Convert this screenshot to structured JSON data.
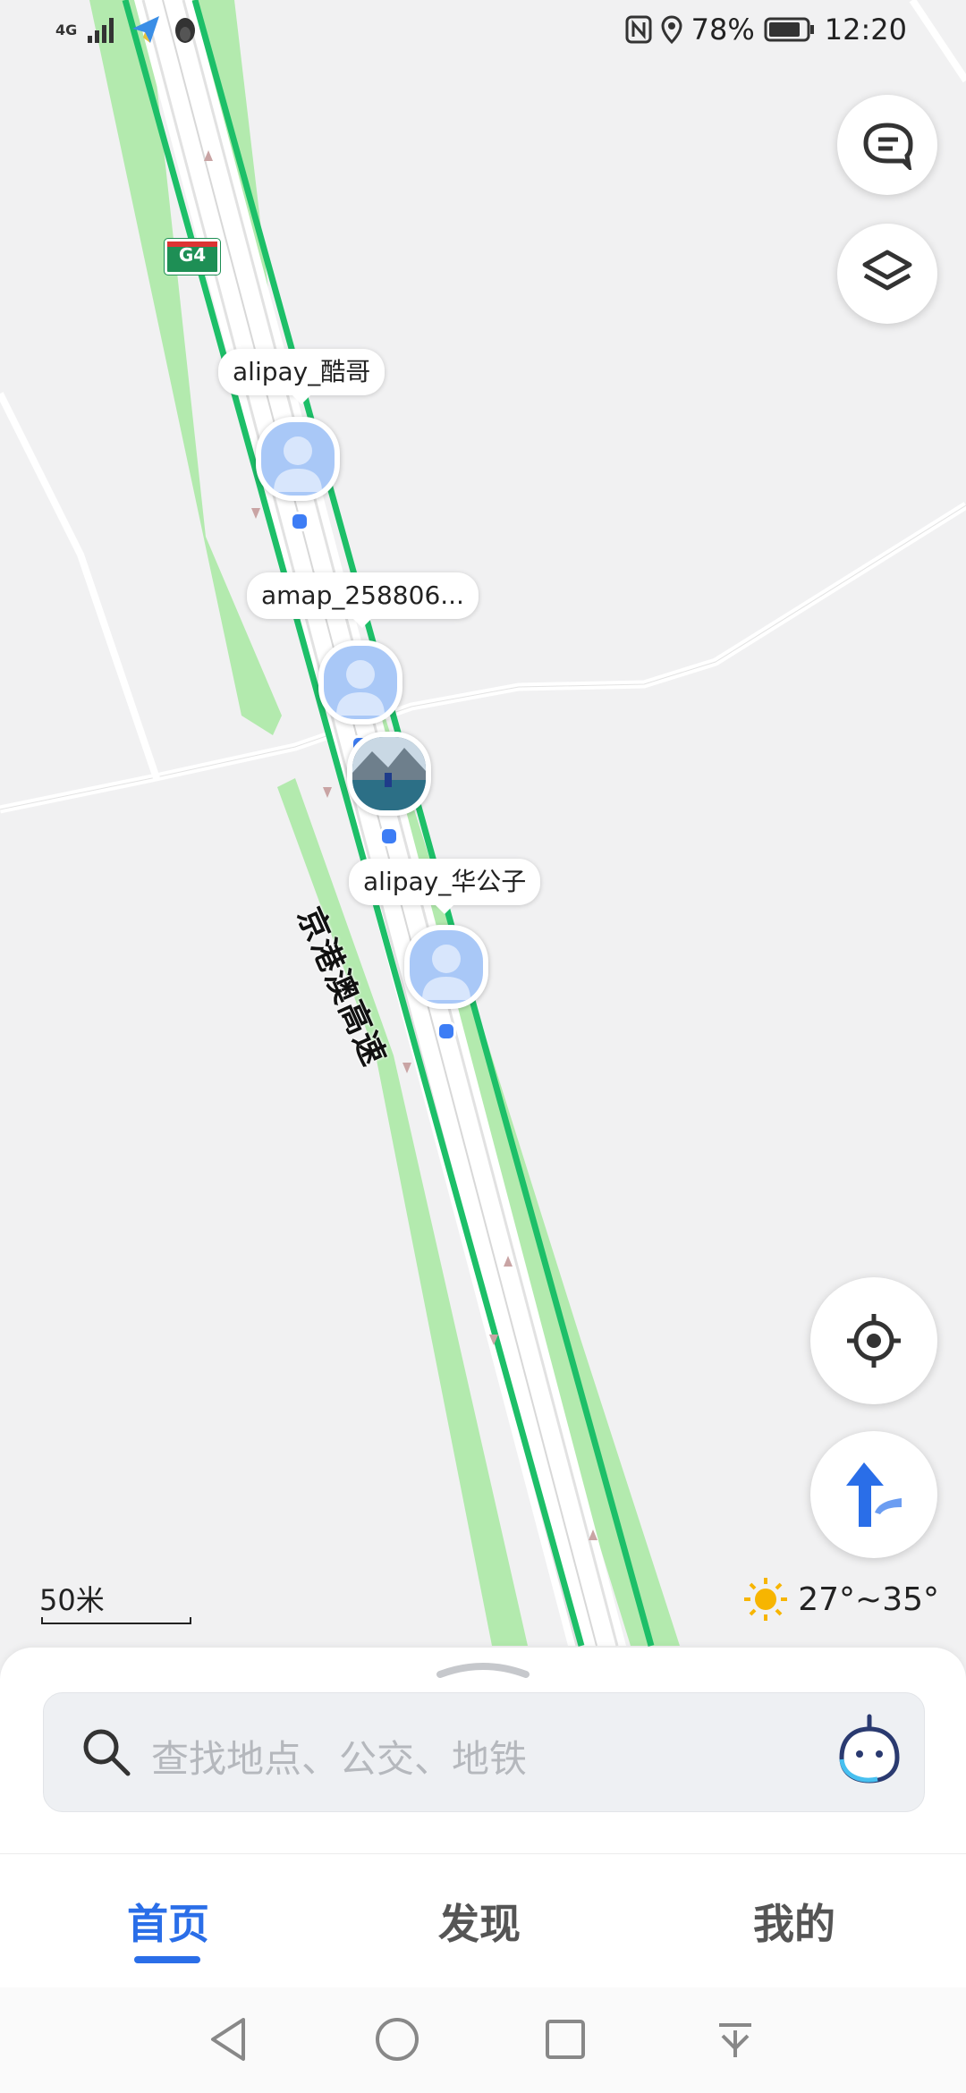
{
  "status_bar": {
    "network": "4G",
    "battery": "78%",
    "time": "12:20",
    "icons": [
      "signal-icon",
      "paper-plane-icon",
      "penguin-icon",
      "nfc-icon",
      "location-pin-icon",
      "battery-icon"
    ]
  },
  "map": {
    "road_name": "京港澳高速",
    "road_shield": "G4",
    "markers": [
      {
        "label": "alipay_酷哥",
        "type": "default-avatar"
      },
      {
        "label": "amap_258806...",
        "type": "default-avatar"
      },
      {
        "label": "",
        "type": "photo-avatar"
      },
      {
        "label": "alipay_华公子",
        "type": "default-avatar"
      }
    ],
    "scale_label": "50米",
    "weather": "27°~35°",
    "colors": {
      "road_green": "#1dbf68",
      "road_buffer": "#b3eaae",
      "background": "#f1f1f2",
      "accent": "#2a6ee8"
    }
  },
  "controls": {
    "message": "message-icon",
    "layers": "layers-icon",
    "locate": "locate-icon",
    "navigate": "route-arrow-icon"
  },
  "search": {
    "placeholder": "查找地点、公交、地铁",
    "assistant": "assistant-bot-icon"
  },
  "tabs": [
    {
      "label": "首页",
      "active": true
    },
    {
      "label": "发现",
      "active": false
    },
    {
      "label": "我的",
      "active": false
    }
  ],
  "nav_bar": [
    "back-icon",
    "home-icon",
    "recents-icon",
    "notification-pull-icon"
  ]
}
